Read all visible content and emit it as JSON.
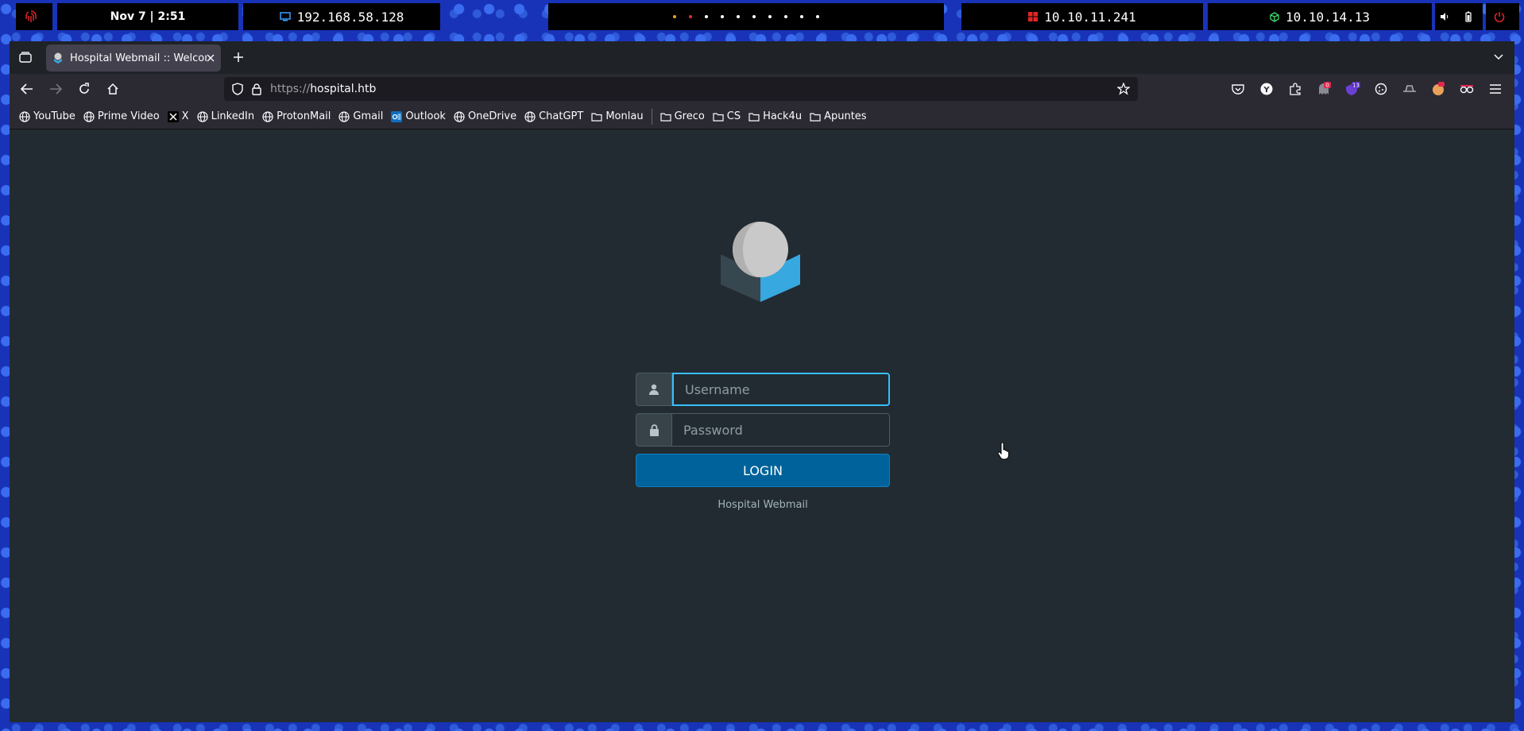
{
  "desktop": {
    "datetime": "Nov 7 | 2:51",
    "local_ip": "192.168.58.128",
    "target_ip": "10.10.11.241",
    "vpn_ip": "10.10.14.13"
  },
  "browser": {
    "tab_title": "Hospital Webmail :: Welcome",
    "url_prefix": "https://",
    "url_host": "hospital.htb",
    "badges": {
      "notif": "0",
      "ext": "13"
    },
    "bookmarks": [
      {
        "label": "YouTube",
        "icon": "globe-icon"
      },
      {
        "label": "Prime Video",
        "icon": "globe-icon"
      },
      {
        "label": "X",
        "icon": "x-logo-icon"
      },
      {
        "label": "LinkedIn",
        "icon": "globe-icon"
      },
      {
        "label": "ProtonMail",
        "icon": "globe-icon"
      },
      {
        "label": "Gmail",
        "icon": "globe-icon"
      },
      {
        "label": "Outlook",
        "icon": "outlook-icon"
      },
      {
        "label": "OneDrive",
        "icon": "globe-icon"
      },
      {
        "label": "ChatGPT",
        "icon": "globe-icon"
      },
      {
        "label": "Monlau",
        "icon": "folder-icon"
      }
    ],
    "bookmark_folders": [
      "Greco",
      "CS",
      "Hack4u",
      "Apuntes"
    ]
  },
  "login": {
    "username_placeholder": "Username",
    "password_placeholder": "Password",
    "button_label": "LOGIN",
    "footer": "Hospital Webmail"
  },
  "colors": {
    "accent": "#37beff",
    "button": "#00629a",
    "page_bg": "#222b31"
  }
}
